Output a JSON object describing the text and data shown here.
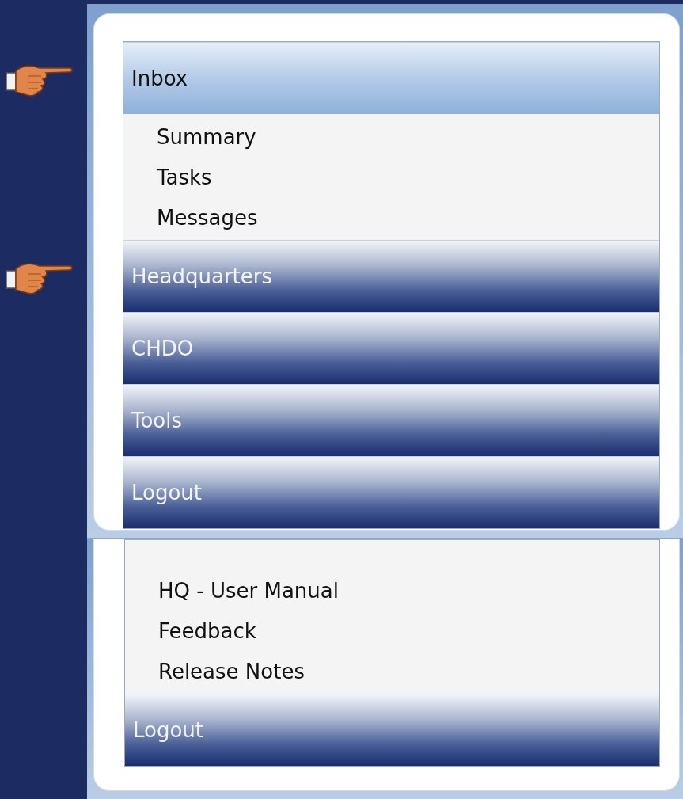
{
  "top_menu": {
    "sections": [
      {
        "label": "Inbox",
        "expanded": true,
        "pointer": true,
        "items": [
          "Summary",
          "Tasks",
          "Messages"
        ]
      },
      {
        "label": "Headquarters",
        "expanded": false,
        "pointer": true
      },
      {
        "label": "CHDO",
        "expanded": false,
        "pointer": false
      },
      {
        "label": "Tools",
        "expanded": false,
        "pointer": false
      },
      {
        "label": "Logout",
        "expanded": false,
        "pointer": false
      }
    ]
  },
  "bottom_menu": {
    "items": [
      "HQ - User Manual",
      "Feedback",
      "Release Notes"
    ],
    "sections": [
      {
        "label": "Logout",
        "expanded": false
      }
    ]
  }
}
